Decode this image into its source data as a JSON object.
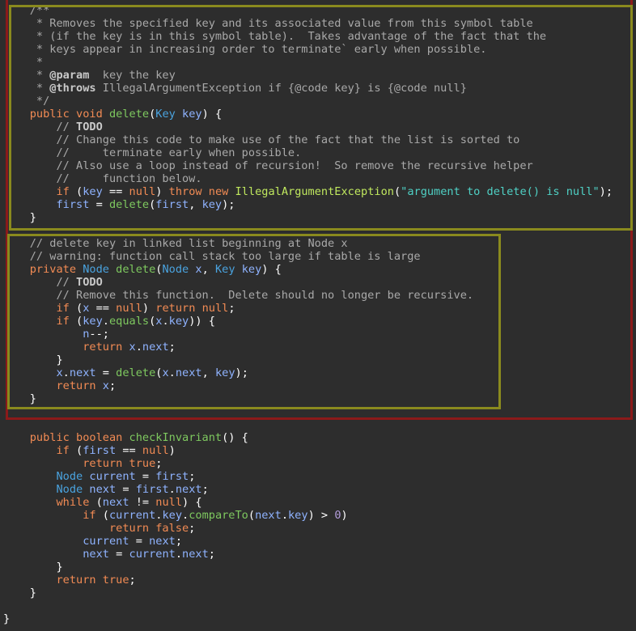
{
  "colors": {
    "background": "#2d2d2d",
    "comment": "#a9a9a9",
    "keyword": "#f28b54",
    "type": "#4aa3df",
    "method": "#7ec95f",
    "variable": "#8fb3ff",
    "string": "#4fd1c5",
    "class_name": "#c0e85e",
    "number": "#b39ddb",
    "outer_highlight": "#8b1a1a",
    "inner_highlight": "#8a8a1e"
  },
  "code": {
    "lines": [
      [
        [
          "c",
          "    /**"
        ]
      ],
      [
        [
          "c",
          "     * Removes the specified key and its associated value from this symbol table"
        ]
      ],
      [
        [
          "c",
          "     * (if the key is in this symbol table).  Takes advantage of the fact that the"
        ]
      ],
      [
        [
          "c",
          "     * keys appear in increasing order to terminate` early when possible."
        ]
      ],
      [
        [
          "c",
          "     *"
        ]
      ],
      [
        [
          "c",
          "     * "
        ],
        [
          "g",
          "@param"
        ],
        [
          "c",
          "  key the key"
        ]
      ],
      [
        [
          "c",
          "     * "
        ],
        [
          "g",
          "@throws"
        ],
        [
          "c",
          " IllegalArgumentException if {@code key} is {@code null}"
        ]
      ],
      [
        [
          "c",
          "     */"
        ]
      ],
      [
        [
          "p",
          "    "
        ],
        [
          "k",
          "public"
        ],
        [
          "p",
          " "
        ],
        [
          "k",
          "void"
        ],
        [
          "p",
          " "
        ],
        [
          "m",
          "delete"
        ],
        [
          "p",
          "("
        ],
        [
          "t",
          "Key"
        ],
        [
          "p",
          " "
        ],
        [
          "v",
          "key"
        ],
        [
          "p",
          ") {"
        ]
      ],
      [
        [
          "c",
          "        // "
        ],
        [
          "g",
          "TODO"
        ]
      ],
      [
        [
          "c",
          "        // Change this code to make use of the fact that the list is sorted to"
        ]
      ],
      [
        [
          "c",
          "        //     terminate early when possible."
        ]
      ],
      [
        [
          "c",
          "        // Also use a loop instead of recursion!  So remove the recursive helper"
        ]
      ],
      [
        [
          "c",
          "        //     function below."
        ]
      ],
      [
        [
          "p",
          "        "
        ],
        [
          "k",
          "if"
        ],
        [
          "p",
          " ("
        ],
        [
          "v",
          "key"
        ],
        [
          "p",
          " == "
        ],
        [
          "k",
          "null"
        ],
        [
          "p",
          ") "
        ],
        [
          "k",
          "throw"
        ],
        [
          "p",
          " "
        ],
        [
          "k",
          "new"
        ],
        [
          "p",
          " "
        ],
        [
          "x",
          "IllegalArgumentException"
        ],
        [
          "p",
          "("
        ],
        [
          "s",
          "\"argument to delete() is null\""
        ],
        [
          "p",
          ");"
        ]
      ],
      [
        [
          "p",
          "        "
        ],
        [
          "v",
          "first"
        ],
        [
          "p",
          " = "
        ],
        [
          "m",
          "delete"
        ],
        [
          "p",
          "("
        ],
        [
          "v",
          "first"
        ],
        [
          "p",
          ", "
        ],
        [
          "v",
          "key"
        ],
        [
          "p",
          ");"
        ]
      ],
      [
        [
          "p",
          "    }"
        ]
      ],
      [
        [
          "p",
          ""
        ]
      ],
      [
        [
          "c",
          "    // delete key in linked list beginning at Node x"
        ]
      ],
      [
        [
          "c",
          "    // warning: function call stack too large if table is large"
        ]
      ],
      [
        [
          "p",
          "    "
        ],
        [
          "k",
          "private"
        ],
        [
          "p",
          " "
        ],
        [
          "t",
          "Node"
        ],
        [
          "p",
          " "
        ],
        [
          "m",
          "delete"
        ],
        [
          "p",
          "("
        ],
        [
          "t",
          "Node"
        ],
        [
          "p",
          " "
        ],
        [
          "v",
          "x"
        ],
        [
          "p",
          ", "
        ],
        [
          "t",
          "Key"
        ],
        [
          "p",
          " "
        ],
        [
          "v",
          "key"
        ],
        [
          "p",
          ") {"
        ]
      ],
      [
        [
          "c",
          "        // "
        ],
        [
          "g",
          "TODO"
        ]
      ],
      [
        [
          "c",
          "        // Remove this function.  Delete should no longer be recursive."
        ]
      ],
      [
        [
          "p",
          "        "
        ],
        [
          "k",
          "if"
        ],
        [
          "p",
          " ("
        ],
        [
          "v",
          "x"
        ],
        [
          "p",
          " == "
        ],
        [
          "k",
          "null"
        ],
        [
          "p",
          ") "
        ],
        [
          "k",
          "return"
        ],
        [
          "p",
          " "
        ],
        [
          "k",
          "null"
        ],
        [
          "p",
          ";"
        ]
      ],
      [
        [
          "p",
          "        "
        ],
        [
          "k",
          "if"
        ],
        [
          "p",
          " ("
        ],
        [
          "v",
          "key"
        ],
        [
          "p",
          "."
        ],
        [
          "m",
          "equals"
        ],
        [
          "p",
          "("
        ],
        [
          "v",
          "x"
        ],
        [
          "p",
          "."
        ],
        [
          "v",
          "key"
        ],
        [
          "p",
          ")) {"
        ]
      ],
      [
        [
          "p",
          "            "
        ],
        [
          "v",
          "n"
        ],
        [
          "p",
          "--;"
        ]
      ],
      [
        [
          "p",
          "            "
        ],
        [
          "k",
          "return"
        ],
        [
          "p",
          " "
        ],
        [
          "v",
          "x"
        ],
        [
          "p",
          "."
        ],
        [
          "v",
          "next"
        ],
        [
          "p",
          ";"
        ]
      ],
      [
        [
          "p",
          "        }"
        ]
      ],
      [
        [
          "p",
          "        "
        ],
        [
          "v",
          "x"
        ],
        [
          "p",
          "."
        ],
        [
          "v",
          "next"
        ],
        [
          "p",
          " = "
        ],
        [
          "m",
          "delete"
        ],
        [
          "p",
          "("
        ],
        [
          "v",
          "x"
        ],
        [
          "p",
          "."
        ],
        [
          "v",
          "next"
        ],
        [
          "p",
          ", "
        ],
        [
          "v",
          "key"
        ],
        [
          "p",
          ");"
        ]
      ],
      [
        [
          "p",
          "        "
        ],
        [
          "k",
          "return"
        ],
        [
          "p",
          " "
        ],
        [
          "v",
          "x"
        ],
        [
          "p",
          ";"
        ]
      ],
      [
        [
          "p",
          "    }"
        ]
      ],
      [
        [
          "p",
          ""
        ]
      ],
      [
        [
          "p",
          ""
        ]
      ],
      [
        [
          "p",
          "    "
        ],
        [
          "k",
          "public"
        ],
        [
          "p",
          " "
        ],
        [
          "k",
          "boolean"
        ],
        [
          "p",
          " "
        ],
        [
          "m",
          "checkInvariant"
        ],
        [
          "p",
          "() {"
        ]
      ],
      [
        [
          "p",
          "        "
        ],
        [
          "k",
          "if"
        ],
        [
          "p",
          " ("
        ],
        [
          "v",
          "first"
        ],
        [
          "p",
          " == "
        ],
        [
          "k",
          "null"
        ],
        [
          "p",
          ")"
        ]
      ],
      [
        [
          "p",
          "            "
        ],
        [
          "k",
          "return"
        ],
        [
          "p",
          " "
        ],
        [
          "k",
          "true"
        ],
        [
          "p",
          ";"
        ]
      ],
      [
        [
          "p",
          "        "
        ],
        [
          "t",
          "Node"
        ],
        [
          "p",
          " "
        ],
        [
          "v",
          "current"
        ],
        [
          "p",
          " = "
        ],
        [
          "v",
          "first"
        ],
        [
          "p",
          ";"
        ]
      ],
      [
        [
          "p",
          "        "
        ],
        [
          "t",
          "Node"
        ],
        [
          "p",
          " "
        ],
        [
          "v",
          "next"
        ],
        [
          "p",
          " = "
        ],
        [
          "v",
          "first"
        ],
        [
          "p",
          "."
        ],
        [
          "v",
          "next"
        ],
        [
          "p",
          ";"
        ]
      ],
      [
        [
          "p",
          "        "
        ],
        [
          "k",
          "while"
        ],
        [
          "p",
          " ("
        ],
        [
          "v",
          "next"
        ],
        [
          "p",
          " != "
        ],
        [
          "k",
          "null"
        ],
        [
          "p",
          ") {"
        ]
      ],
      [
        [
          "p",
          "            "
        ],
        [
          "k",
          "if"
        ],
        [
          "p",
          " ("
        ],
        [
          "v",
          "current"
        ],
        [
          "p",
          "."
        ],
        [
          "v",
          "key"
        ],
        [
          "p",
          "."
        ],
        [
          "m",
          "compareTo"
        ],
        [
          "p",
          "("
        ],
        [
          "v",
          "next"
        ],
        [
          "p",
          "."
        ],
        [
          "v",
          "key"
        ],
        [
          "p",
          ") > "
        ],
        [
          "n",
          "0"
        ],
        [
          "p",
          ")"
        ]
      ],
      [
        [
          "p",
          "                "
        ],
        [
          "k",
          "return"
        ],
        [
          "p",
          " "
        ],
        [
          "k",
          "false"
        ],
        [
          "p",
          ";"
        ]
      ],
      [
        [
          "p",
          "            "
        ],
        [
          "v",
          "current"
        ],
        [
          "p",
          " = "
        ],
        [
          "v",
          "next"
        ],
        [
          "p",
          ";"
        ]
      ],
      [
        [
          "p",
          "            "
        ],
        [
          "v",
          "next"
        ],
        [
          "p",
          " = "
        ],
        [
          "v",
          "current"
        ],
        [
          "p",
          "."
        ],
        [
          "v",
          "next"
        ],
        [
          "p",
          ";"
        ]
      ],
      [
        [
          "p",
          "        }"
        ]
      ],
      [
        [
          "p",
          "        "
        ],
        [
          "k",
          "return"
        ],
        [
          "p",
          " "
        ],
        [
          "k",
          "true"
        ],
        [
          "p",
          ";"
        ]
      ],
      [
        [
          "p",
          "    }"
        ]
      ],
      [
        [
          "p",
          ""
        ]
      ],
      [
        [
          "p",
          "}"
        ]
      ]
    ]
  }
}
